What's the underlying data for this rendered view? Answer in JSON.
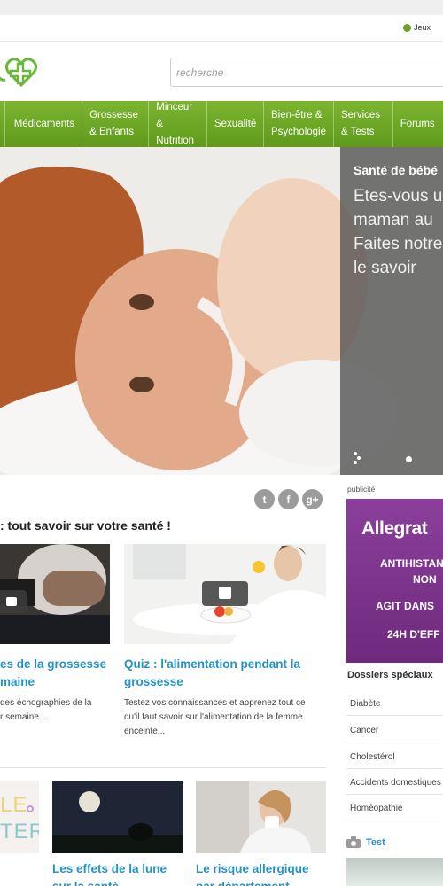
{
  "utility": {
    "games_label": "Jeux"
  },
  "search": {
    "placeholder": "recherche"
  },
  "nav": {
    "items": [
      {
        "label": ""
      },
      {
        "label": "Médicaments"
      },
      {
        "label": "Grossesse & Enfants"
      },
      {
        "label": "Minceur & Nutrition"
      },
      {
        "label": "Sexualité"
      },
      {
        "label": "Bien-être & Psychologie"
      },
      {
        "label": "Services & Tests"
      },
      {
        "label": "Forums"
      }
    ]
  },
  "hero": {
    "kicker": "Santé de bébé",
    "text_line1": "Etes-vous u",
    "text_line2": "maman au",
    "text_line3": "Faites notre",
    "text_line4": "le savoir"
  },
  "main": {
    "section_title": ": tout savoir sur votre santé !",
    "social": {
      "twitter": "t",
      "facebook": "f",
      "gplus": "g+"
    },
    "cards": [
      {
        "title_line1": "es de la grossesse",
        "title_line2": "maine",
        "desc_line1": "des échographies de la",
        "desc_line2": "r semaine..."
      },
      {
        "title_line1": "Quiz : l'alimentation pendant la",
        "title_line2": "grossesse",
        "desc_line1": "Testez vos connaissances et apprenez tout ce",
        "desc_line2": "qu'il faut savoir sur l'alimentation de la femme",
        "desc_line3": "enceinte..."
      },
      {
        "img_text_line1": "LE",
        "img_text_line2": "TER"
      },
      {
        "title_line1": "Les effets de la lune",
        "title_line2": "sur la santé"
      },
      {
        "title_line1": "Le risque allergique",
        "title_line2": "par département"
      }
    ]
  },
  "sidebar": {
    "pub_label": "publicité",
    "ad": {
      "brand": "Allegrat",
      "line1": "ANTIHISTAN",
      "line2": "NON",
      "line3": "AGIT DANS",
      "line4": "24H D'EFF"
    },
    "dossiers_title": "Dossiers spéciaux",
    "dossiers": [
      "Diabète",
      "Cancer",
      "Cholestérol",
      "Accidents domestiques",
      "Homéopathie"
    ],
    "test_label": "Test"
  },
  "colors": {
    "accent_green": "#6aa32a",
    "link_blue": "#2592c4",
    "ad_purple": "#7d3490"
  }
}
